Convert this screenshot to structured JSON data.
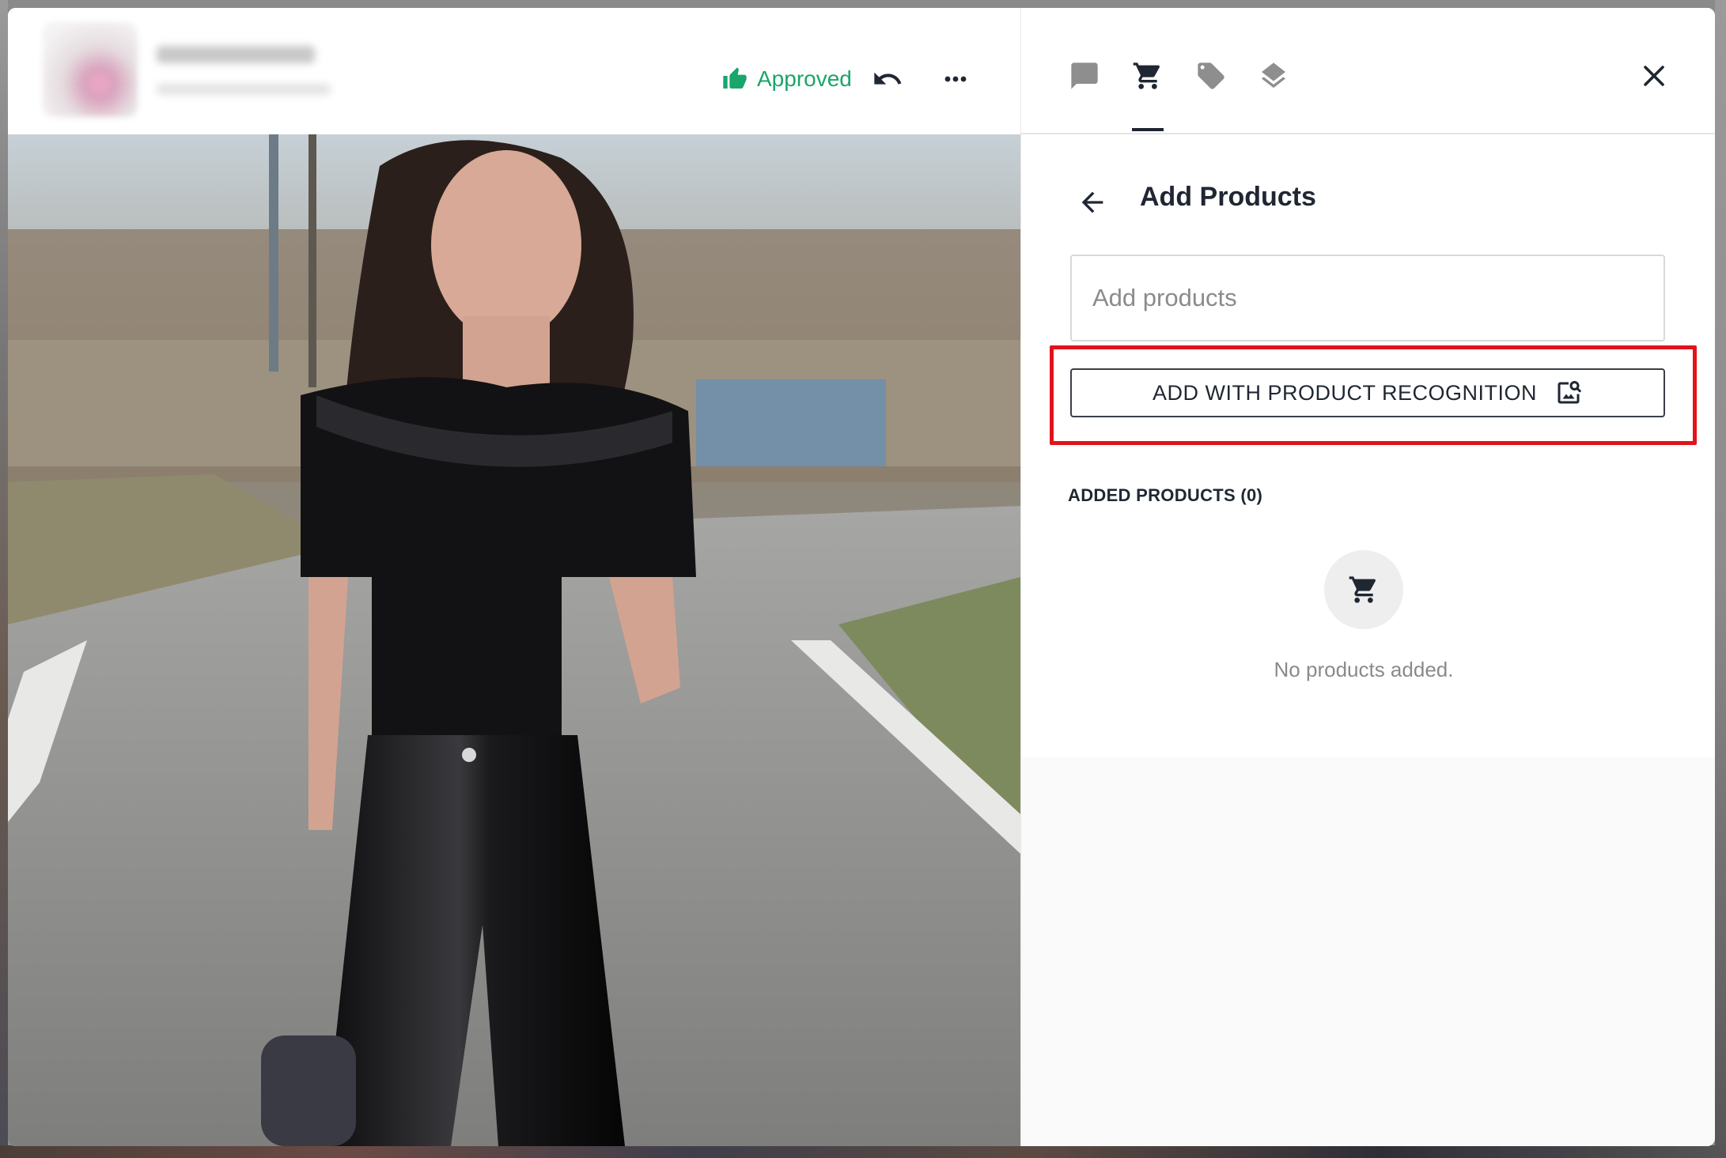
{
  "header": {
    "status_label": "Approved",
    "status_color": "#1aa56b",
    "icons": [
      "thumbs-up-icon",
      "undo-icon",
      "more-icon"
    ]
  },
  "media": {
    "image_description_icon": "photo"
  },
  "side_panel": {
    "tabs": [
      {
        "icon": "chat-icon",
        "active": false
      },
      {
        "icon": "cart-icon",
        "active": true
      },
      {
        "icon": "tag-icon",
        "active": false
      },
      {
        "icon": "layers-icon",
        "active": false
      }
    ],
    "title": "Add Products",
    "search": {
      "placeholder": "Add products",
      "value": ""
    },
    "recognition_button_label": "ADD WITH PRODUCT RECOGNITION",
    "highlight_color": "#e2131b",
    "added_heading": "ADDED PRODUCTS (0)",
    "empty_state_text": "No products added."
  }
}
